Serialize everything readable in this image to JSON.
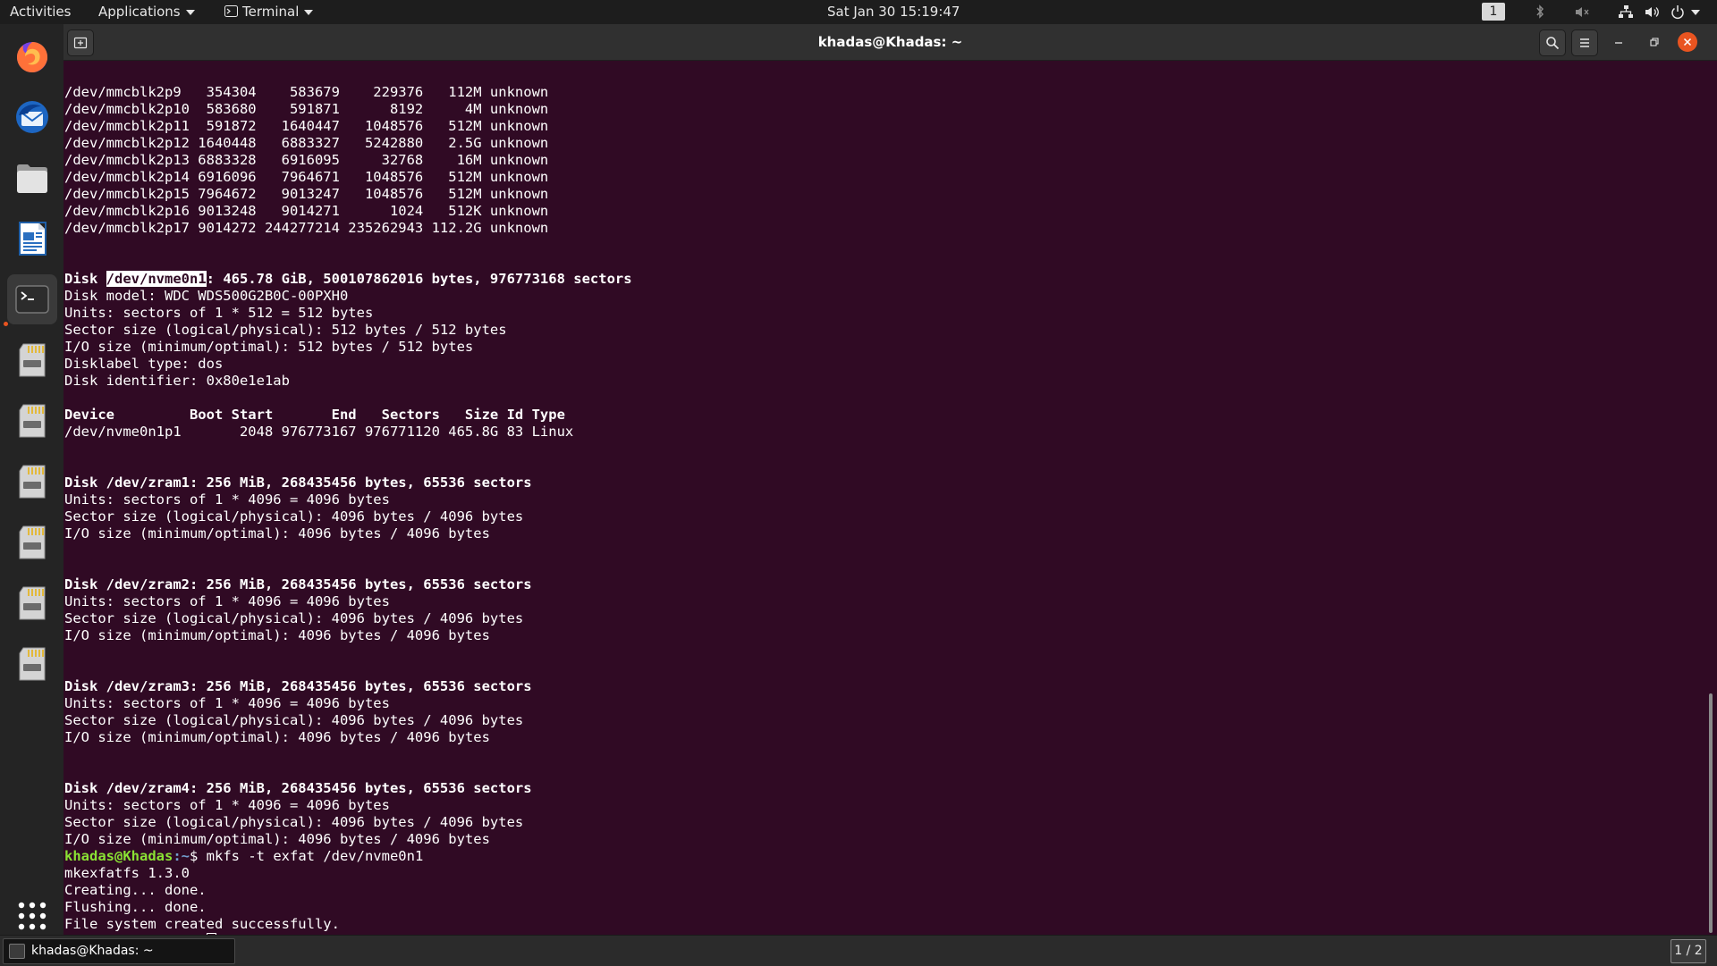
{
  "topbar": {
    "activities": "Activities",
    "applications": "Applications",
    "terminal_menu": "Terminal",
    "clock": "Sat Jan 30  15:19:47",
    "workspace": "1"
  },
  "dock": {
    "items": [
      "firefox",
      "thunderbird",
      "files",
      "libreoffice-writer",
      "terminal",
      "sd-card",
      "sd-card",
      "sd-card",
      "sd-card",
      "sd-card",
      "sd-card"
    ],
    "show_apps": "show-applications"
  },
  "window": {
    "title": "khadas@Khadas: ~"
  },
  "terminal": {
    "partitions": [
      "/dev/mmcblk2p9   354304    583679    229376   112M unknown",
      "/dev/mmcblk2p10  583680    591871      8192     4M unknown",
      "/dev/mmcblk2p11  591872   1640447   1048576   512M unknown",
      "/dev/mmcblk2p12 1640448   6883327   5242880   2.5G unknown",
      "/dev/mmcblk2p13 6883328   6916095     32768    16M unknown",
      "/dev/mmcblk2p14 6916096   7964671   1048576   512M unknown",
      "/dev/mmcblk2p15 7964672   9013247   1048576   512M unknown",
      "/dev/mmcblk2p16 9013248   9014271      1024   512K unknown",
      "/dev/mmcblk2p17 9014272 244277214 235262943 112.2G unknown"
    ],
    "nvme": {
      "disk_prefix": "Disk ",
      "disk_name": "/dev/nvme0n1",
      "disk_suffix": ": 465.78 GiB, 500107862016 bytes, 976773168 sectors",
      "model": "Disk model: WDC WDS500G2B0C-00PXH0",
      "units": "Units: sectors of 1 * 512 = 512 bytes",
      "sector_size": "Sector size (logical/physical): 512 bytes / 512 bytes",
      "io_size": "I/O size (minimum/optimal): 512 bytes / 512 bytes",
      "label_type": "Disklabel type: dos",
      "identifier": "Disk identifier: 0x80e1e1ab",
      "table_header": "Device         Boot Start       End   Sectors   Size Id Type",
      "table_row": "/dev/nvme0n1p1       2048 976773167 976771120 465.8G 83 Linux"
    },
    "zram": [
      {
        "header": "Disk /dev/zram1: 256 MiB, 268435456 bytes, 65536 sectors",
        "units": "Units: sectors of 1 * 4096 = 4096 bytes",
        "sector_size": "Sector size (logical/physical): 4096 bytes / 4096 bytes",
        "io_size": "I/O size (minimum/optimal): 4096 bytes / 4096 bytes"
      },
      {
        "header": "Disk /dev/zram2: 256 MiB, 268435456 bytes, 65536 sectors",
        "units": "Units: sectors of 1 * 4096 = 4096 bytes",
        "sector_size": "Sector size (logical/physical): 4096 bytes / 4096 bytes",
        "io_size": "I/O size (minimum/optimal): 4096 bytes / 4096 bytes"
      },
      {
        "header": "Disk /dev/zram3: 256 MiB, 268435456 bytes, 65536 sectors",
        "units": "Units: sectors of 1 * 4096 = 4096 bytes",
        "sector_size": "Sector size (logical/physical): 4096 bytes / 4096 bytes",
        "io_size": "I/O size (minimum/optimal): 4096 bytes / 4096 bytes"
      },
      {
        "header": "Disk /dev/zram4: 256 MiB, 268435456 bytes, 65536 sectors",
        "units": "Units: sectors of 1 * 4096 = 4096 bytes",
        "sector_size": "Sector size (logical/physical): 4096 bytes / 4096 bytes",
        "io_size": "I/O size (minimum/optimal): 4096 bytes / 4096 bytes"
      }
    ],
    "prompt_user": "khadas@Khadas",
    "prompt_path": ":~",
    "prompt_symbol": "$ ",
    "command": "mkfs -t exfat /dev/nvme0n1",
    "output": [
      "mkexfatfs 1.3.0",
      "Creating... done.",
      "Flushing... done.",
      "File system created successfully."
    ]
  },
  "taskbar": {
    "task_label": "khadas@Khadas: ~",
    "workspace_indicator": "1 / 2"
  },
  "colors": {
    "terminal_bg": "#300a24",
    "prompt_green": "#8ae234",
    "close_button": "#e95420"
  }
}
